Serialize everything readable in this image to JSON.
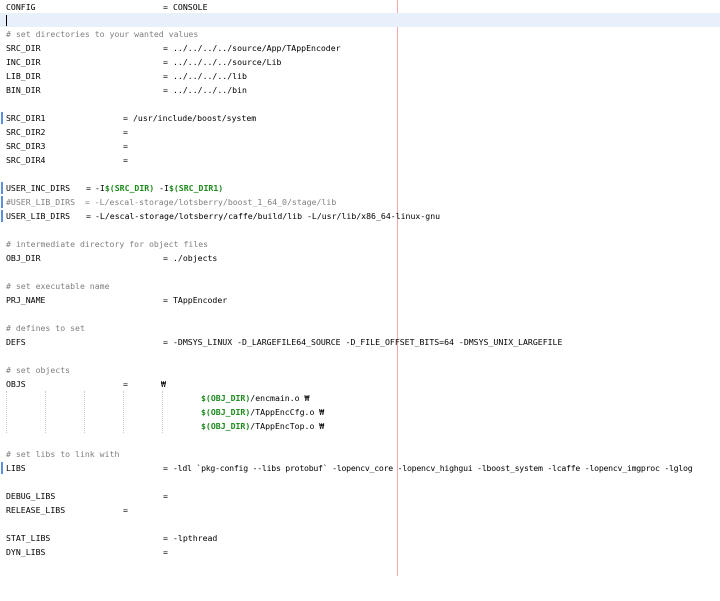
{
  "editor": {
    "lines": {
      "config": {
        "name": "CONFIG",
        "eq": "=",
        "value": "CONSOLE"
      },
      "c_dirs": {
        "text": "# set directories to your wanted values"
      },
      "src_dir": {
        "name": "SRC_DIR",
        "eq": "=",
        "value": "../../../../source/App/TAppEncoder"
      },
      "inc_dir": {
        "name": "INC_DIR",
        "eq": "=",
        "value": "../../../../source/Lib"
      },
      "lib_dir": {
        "name": "LIB_DIR",
        "eq": "=",
        "value": "../../../../lib"
      },
      "bin_dir": {
        "name": "BIN_DIR",
        "eq": "=",
        "value": "../../../../bin"
      },
      "src_dir1": {
        "name": "SRC_DIR1",
        "eq": "=",
        "value": "/usr/include/boost/system"
      },
      "src_dir2": {
        "name": "SRC_DIR2",
        "eq": "="
      },
      "src_dir3": {
        "name": "SRC_DIR3",
        "eq": "="
      },
      "src_dir4": {
        "name": "SRC_DIR4",
        "eq": "="
      },
      "user_inc_dirs": {
        "name": "USER_INC_DIRS",
        "eq": "=",
        "value_prefix": "-I",
        "ref1": "$(SRC_DIR)",
        "value_mid": " -I",
        "ref2": "$(SRC_DIR1)"
      },
      "user_lib_dirs_c": {
        "text": "#USER_LIB_DIRS  = -L/escal-storage/lotsberry/boost_1_64_0/stage/lib"
      },
      "user_lib_dirs": {
        "name": "USER_LIB_DIRS",
        "eq": "=",
        "value": "-L/escal-storage/lotsberry/caffe/build/lib -L/usr/lib/x86_64-linux-gnu"
      },
      "c_obj_dir": {
        "text": "# intermediate directory for object files"
      },
      "obj_dir": {
        "name": "OBJ_DIR",
        "eq": "=",
        "value": "./objects"
      },
      "c_exe": {
        "text": "# set executable name"
      },
      "prj_name": {
        "name": "PRJ_NAME",
        "eq": "=",
        "value": "TAppEncoder"
      },
      "c_defines": {
        "text": "# defines to set"
      },
      "defs": {
        "name": "DEFS",
        "eq": "=",
        "value": "-DMSYS_LINUX -D_LARGEFILE64_SOURCE -D_FILE_OFFSET_BITS=64 -DMSYS_UNIX_LARGEFILE"
      },
      "c_objects": {
        "text": "# set objects"
      },
      "objs": {
        "name": "OBJS",
        "eq": "=",
        "cont": "₩"
      },
      "obj1": {
        "ref": "$(OBJ_DIR)",
        "file": "/encmain.o ₩"
      },
      "obj2": {
        "ref": "$(OBJ_DIR)",
        "file": "/TAppEncCfg.o ₩"
      },
      "obj3": {
        "ref": "$(OBJ_DIR)",
        "file": "/TAppEncTop.o ₩"
      },
      "c_libs": {
        "text": "# set libs to link with"
      },
      "libs": {
        "name": "LIBS",
        "eq": "=",
        "value": "-ldl `pkg-config --libs protobuf` -lopencv_core -lopencv_highgui -lboost_system -lcaffe -lopencv_imgproc -lglog"
      },
      "debug_libs": {
        "name": "DEBUG_LIBS",
        "eq": "="
      },
      "release_libs": {
        "name": "RELEASE_LIBS",
        "eq": "="
      },
      "stat_libs": {
        "name": "STAT_LIBS",
        "eq": "=",
        "value": "-lpthread"
      },
      "dyn_libs": {
        "name": "DYN_LIBS",
        "eq": "="
      }
    },
    "colors": {
      "comment": "#7f7f7f",
      "variable_reference": "#1b8a1b",
      "current_line": "#e8f0fb",
      "modified_marker": "#5b8fd9",
      "edge_ruler": "#f0a8a8"
    }
  }
}
